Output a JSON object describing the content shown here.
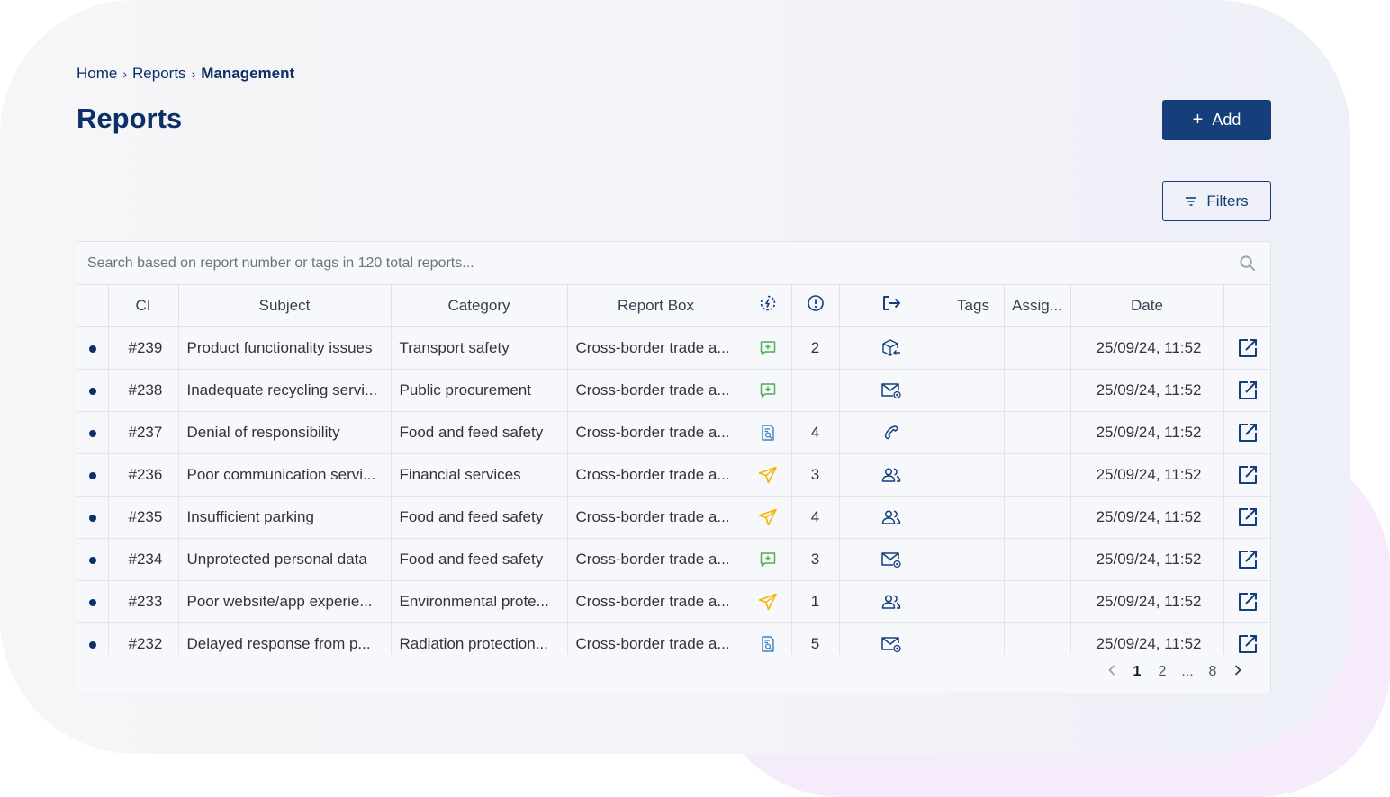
{
  "breadcrumb": {
    "home": "Home",
    "reports": "Reports",
    "current": "Management",
    "sep": "›"
  },
  "page": {
    "title": "Reports"
  },
  "actions": {
    "add_label": "Add",
    "filter_label": "Filters"
  },
  "search": {
    "placeholder": "Search based on report number or tags in 120 total reports..."
  },
  "table": {
    "headers": {
      "ci": "CI",
      "subject": "Subject",
      "category": "Category",
      "report_box": "Report Box",
      "status_icon": "status-icon",
      "priority_icon": "alert-icon",
      "channel_icon": "exit-arrow-icon",
      "tags": "Tags",
      "assignee": "Assig...",
      "date": "Date"
    },
    "rows": [
      {
        "id": "#239",
        "subject": "Product functionality issues",
        "category": "Transport safety",
        "box": "Cross-border trade a...",
        "status": "message-plus",
        "count": "2",
        "channel": "package-return",
        "tags": "",
        "assignee": "",
        "date": "25/09/24, 11:52"
      },
      {
        "id": "#238",
        "subject": "Inadequate recycling servi...",
        "category": "Public procurement",
        "box": "Cross-border trade a...",
        "status": "message-plus",
        "count": "",
        "channel": "email",
        "tags": "",
        "assignee": "",
        "date": "25/09/24, 11:52"
      },
      {
        "id": "#237",
        "subject": "Denial of responsibility",
        "category": "Food and feed safety",
        "box": "Cross-border trade a...",
        "status": "document-search",
        "count": "4",
        "channel": "phone",
        "tags": "",
        "assignee": "",
        "date": "25/09/24, 11:52"
      },
      {
        "id": "#236",
        "subject": "Poor communication servi...",
        "category": "Financial services",
        "box": "Cross-border trade a...",
        "status": "send",
        "count": "3",
        "channel": "users",
        "tags": "",
        "assignee": "",
        "date": "25/09/24, 11:52"
      },
      {
        "id": "#235",
        "subject": "Insufficient parking",
        "category": "Food and feed safety",
        "box": "Cross-border trade a...",
        "status": "send",
        "count": "4",
        "channel": "users",
        "tags": "",
        "assignee": "",
        "date": "25/09/24, 11:52"
      },
      {
        "id": "#234",
        "subject": "Unprotected personal data",
        "category": "Food and feed safety",
        "box": "Cross-border trade a...",
        "status": "message-plus",
        "count": "3",
        "channel": "email",
        "tags": "",
        "assignee": "",
        "date": "25/09/24, 11:52"
      },
      {
        "id": "#233",
        "subject": "Poor website/app experie...",
        "category": "Environmental prote...",
        "box": "Cross-border trade a...",
        "status": "send",
        "count": "1",
        "channel": "users",
        "tags": "",
        "assignee": "",
        "date": "25/09/24, 11:52"
      },
      {
        "id": "#232",
        "subject": "Delayed response from p...",
        "category": "Radiation protection...",
        "box": "Cross-border trade a...",
        "status": "document-search",
        "count": "5",
        "channel": "email",
        "tags": "",
        "assignee": "",
        "date": "25/09/24, 11:52"
      }
    ]
  },
  "pagination": {
    "pages": [
      "1",
      "2",
      "...",
      "8"
    ],
    "current": "1"
  },
  "colors": {
    "primary": "#143f7a",
    "title": "#0b2f66",
    "green": "#4caf50",
    "yellow": "#f5b400",
    "blue": "#3b82c4"
  }
}
